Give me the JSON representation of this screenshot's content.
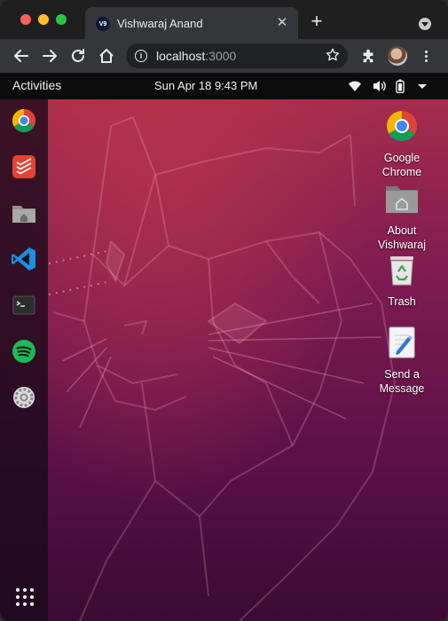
{
  "browser": {
    "tab": {
      "favicon_text": "V9",
      "title": "Vishwaraj Anand"
    },
    "address": {
      "host": "localhost",
      "port": ":3000"
    }
  },
  "topbar": {
    "activities": "Activities",
    "clock": "Sun Apr 18  9:43 PM"
  },
  "dock": {
    "items": [
      "chrome-icon",
      "todoist-icon",
      "files-icon",
      "vscode-icon",
      "terminal-icon",
      "spotify-icon",
      "settings-icon"
    ],
    "show_apps": "apps-grid-icon"
  },
  "desktop": {
    "icons": [
      {
        "label_line1": "Google",
        "label_line2": "Chrome",
        "icon": "chrome-icon"
      },
      {
        "label_line1": "About",
        "label_line2": "Vishwaraj",
        "icon": "folder-home-icon"
      },
      {
        "label_line1": "Trash",
        "label_line2": "",
        "icon": "trash-icon"
      },
      {
        "label_line1": "Send a",
        "label_line2": "Message",
        "icon": "text-editor-icon"
      }
    ]
  },
  "colors": {
    "wallpaper_top": "#a52c4d",
    "wallpaper_bottom": "#3a0b35",
    "tab_bg": "#35363a",
    "topbar_bg": "#0c0c0c"
  }
}
